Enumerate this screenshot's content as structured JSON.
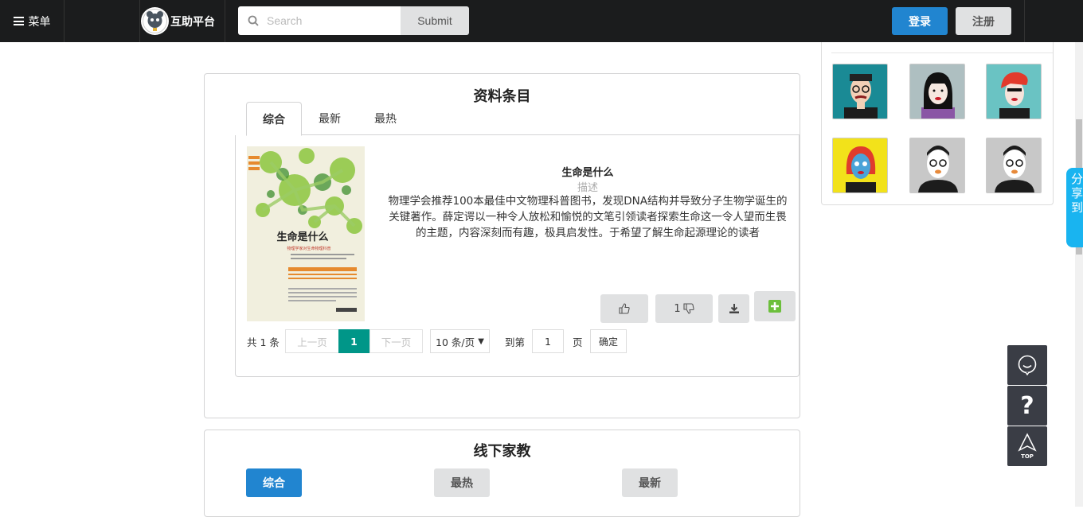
{
  "navbar": {
    "menu_label": "菜单",
    "brand_name": "互助平台",
    "search_placeholder": "Search",
    "search_submit": "Submit",
    "login": "登录",
    "register": "注册"
  },
  "share_tab": {
    "text": "分享到："
  },
  "materials": {
    "title": "资料条目",
    "tabs": [
      "综合",
      "最新",
      "最热"
    ],
    "active_tab": "综合",
    "item": {
      "title": "生命是什么",
      "subtitle": "描述",
      "description": "物理学会推荐100本最佳中文物理科普图书，发现DNA结构并导致分子生物学诞生的关键著作。薛定谔以一种令人放松和愉悦的文笔引领读者探索生命这一令人望而生畏的主题，内容深刻而有趣，极具启发性。于希望了解生命起源理论的读者",
      "cover_title": "生命是什么",
      "cover_subtitle": "物理学家对生命物理科普",
      "dislike_count": "1"
    },
    "pager": {
      "total": "共 1 条",
      "prev": "上一页",
      "current_page": "1",
      "next": "下一页",
      "page_size": "10 条/页",
      "goto_label": "到第",
      "goto_value": "1",
      "page_unit": "页",
      "confirm": "确定"
    }
  },
  "tutoring": {
    "title": "线下家教",
    "filters": [
      "综合",
      "最热",
      "最新"
    ]
  },
  "side_tools": [
    "chat-icon",
    "help-icon",
    "top-icon"
  ],
  "colors": {
    "navbar_bg": "#1b1c1d",
    "primary": "#2185d0",
    "pager_active": "#009688",
    "share": "#19b4f0",
    "tool_bg": "#3a3d45"
  }
}
